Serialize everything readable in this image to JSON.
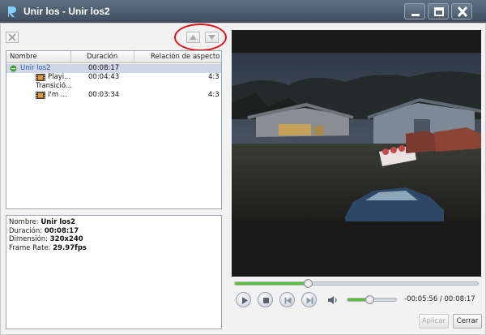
{
  "window": {
    "title": "Unir los - Unir los2"
  },
  "list": {
    "columns": [
      "Nombre",
      "Duración",
      "Relación de aspecto"
    ],
    "rows": [
      {
        "name": "Unir los2",
        "duration": "00:08:17",
        "aspect": ""
      },
      {
        "name": "Playi...",
        "duration": "00:04:43",
        "aspect": "4:3"
      },
      {
        "name": "Transició...",
        "duration": "",
        "aspect": ""
      },
      {
        "name": "I'm ...",
        "duration": "00:03:34",
        "aspect": "4:3"
      }
    ]
  },
  "info": {
    "nombre_label": "Nombre:",
    "nombre_value": "Unir los2",
    "duracion_label": "Duración:",
    "duracion_value": "00:08:17",
    "dimension_label": "Dimensión:",
    "dimension_value": "320x240",
    "framerate_label": "Frame Rate:",
    "framerate_value": "29.97fps"
  },
  "player": {
    "progress": 0.3,
    "volume": 0.45,
    "time_display": "-00:05:56 / 00:08:17"
  },
  "buttons": {
    "apply": "Aplicar",
    "close": "Cerrar"
  },
  "colors": {
    "titlebar": "#4b5a6c",
    "accent_green": "#56c23a",
    "selection": "#cfd6ea",
    "highlight_circle": "#e0141b"
  },
  "icons": [
    "app-logo-icon",
    "minimize-icon",
    "maximize-icon",
    "close-icon",
    "clear-icon",
    "move-up-icon",
    "move-down-icon",
    "film-icon",
    "play-icon",
    "stop-icon",
    "previous-icon",
    "next-icon",
    "volume-icon"
  ]
}
